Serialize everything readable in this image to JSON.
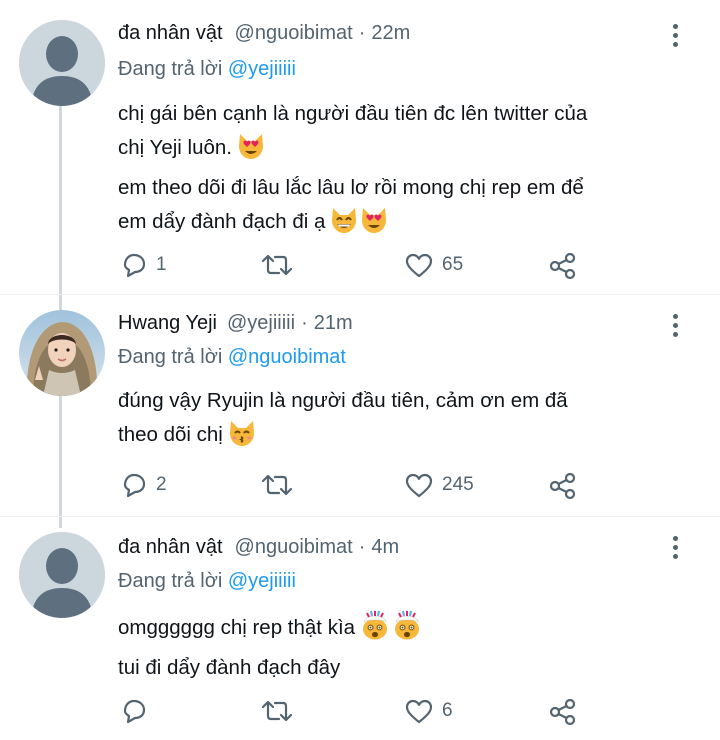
{
  "tweets": [
    {
      "name": "đa nhân vật",
      "handle": "@nguoibimat",
      "dot": "·",
      "time": "22m",
      "reply_prefix": "Đang trả lời",
      "reply_mention": "@yejiiiii",
      "lines": [
        "chị gái bên cạnh là người đầu tiên đc lên twitter của",
        "chị Yeji luôn.",
        "em theo dõi đi lâu lắc lâu lơ rồi mong chị rep em để",
        "em dẩy đành đạch đi ạ"
      ],
      "emojis": [
        "smiling-cat-heart-eyes",
        "grinning-cat-smiling-eyes",
        "smiling-cat-heart-eyes"
      ],
      "reply_count": "1",
      "retweet_count": "",
      "like_count": "65"
    },
    {
      "name": "Hwang Yeji",
      "handle": "@yejiiiii",
      "dot": "·",
      "time": "21m",
      "reply_prefix": "Đang trả lời",
      "reply_mention": "@nguoibimat",
      "lines": [
        "đúng vậy Ryujin là người đầu tiên,  cảm ơn em đã",
        "theo dõi chị"
      ],
      "emojis": [
        "kissing-cat"
      ],
      "reply_count": "2",
      "retweet_count": "",
      "like_count": "245"
    },
    {
      "name": "đa nhân vật",
      "handle": "@nguoibimat",
      "dot": "·",
      "time": "4m",
      "reply_prefix": "Đang trả lời",
      "reply_mention": "@yejiiiii",
      "lines": [
        "omgggggg chị rep thật kìa",
        "tui đi dẩy đành đạch đây"
      ],
      "emojis": [
        "exploding-head",
        "exploding-head"
      ],
      "reply_count": "",
      "retweet_count": "",
      "like_count": "6"
    }
  ],
  "colors": {
    "text": "#0f1419",
    "secondary": "#536471",
    "mention": "#1d9bf0",
    "thread_line": "#cfd9de",
    "avatar_default_bg": "#ccd6dd",
    "avatar_default_fg": "#5e6f80"
  }
}
